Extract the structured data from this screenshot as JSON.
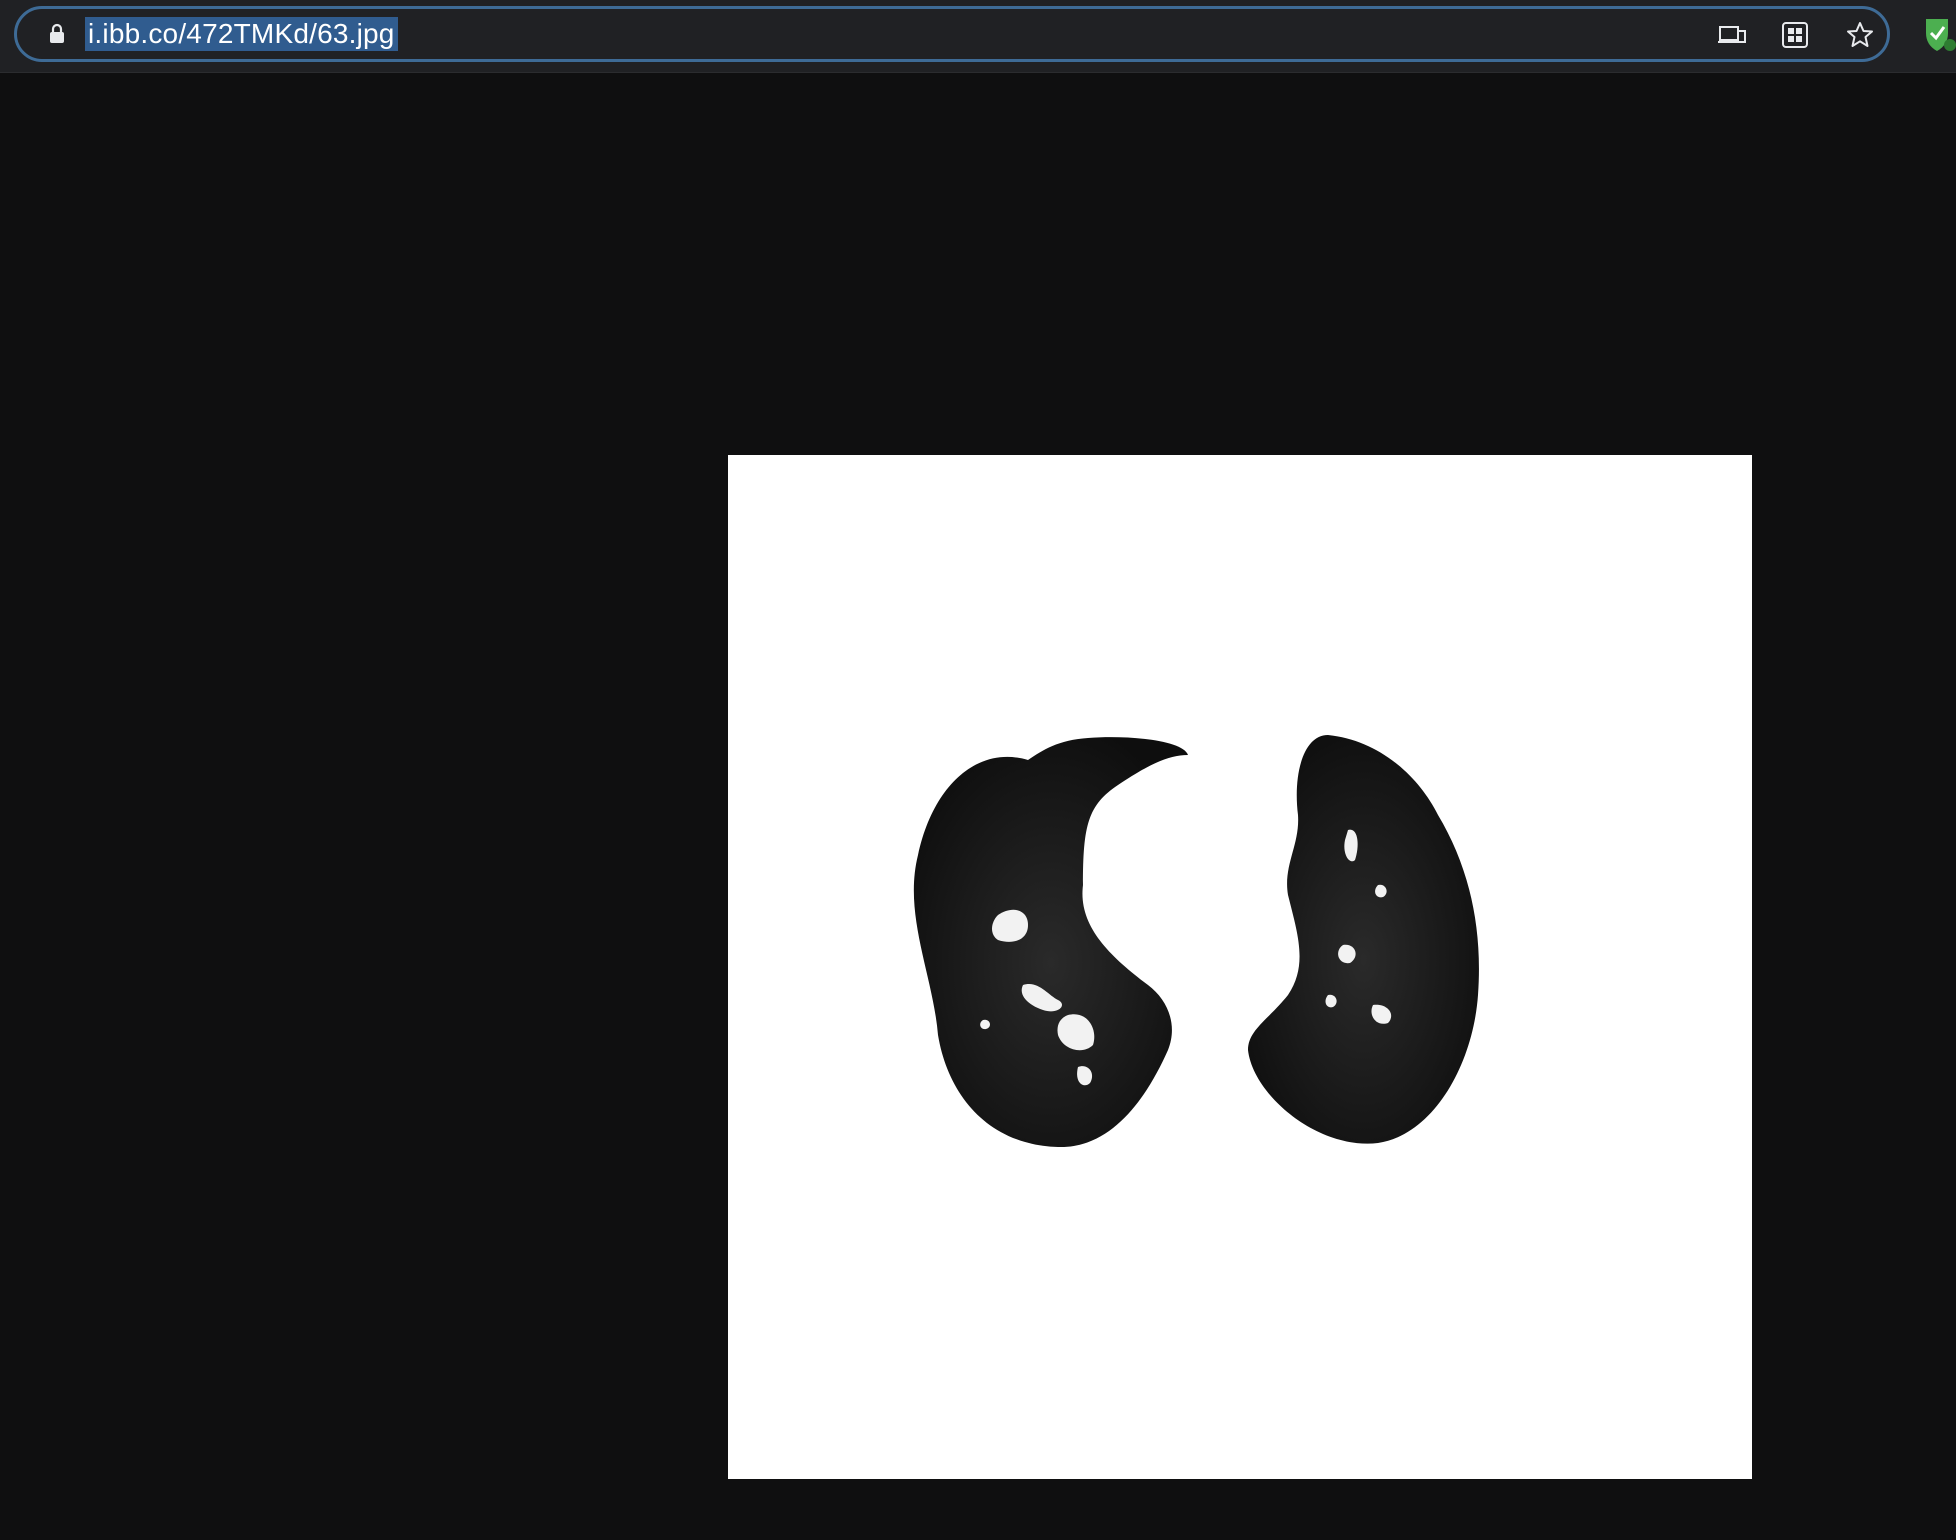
{
  "browser": {
    "address_bar": {
      "url": "i.ibb.co/472TMKd/63.jpg",
      "url_selected": true,
      "icons": [
        "lock-icon",
        "cast-device-icon",
        "qr-code-icon",
        "bookmark-star-icon"
      ]
    },
    "extension_icon": "shield-check-icon",
    "colors": {
      "toolbar": "#202124",
      "omnibox_border": "#3e6b96",
      "selection": "#305c8f",
      "page_background": "#0f0f10"
    }
  },
  "page": {
    "image": {
      "description_icon": "ct-lung-scan-image",
      "background": "#ffffff",
      "subject": "lung-mask"
    }
  }
}
